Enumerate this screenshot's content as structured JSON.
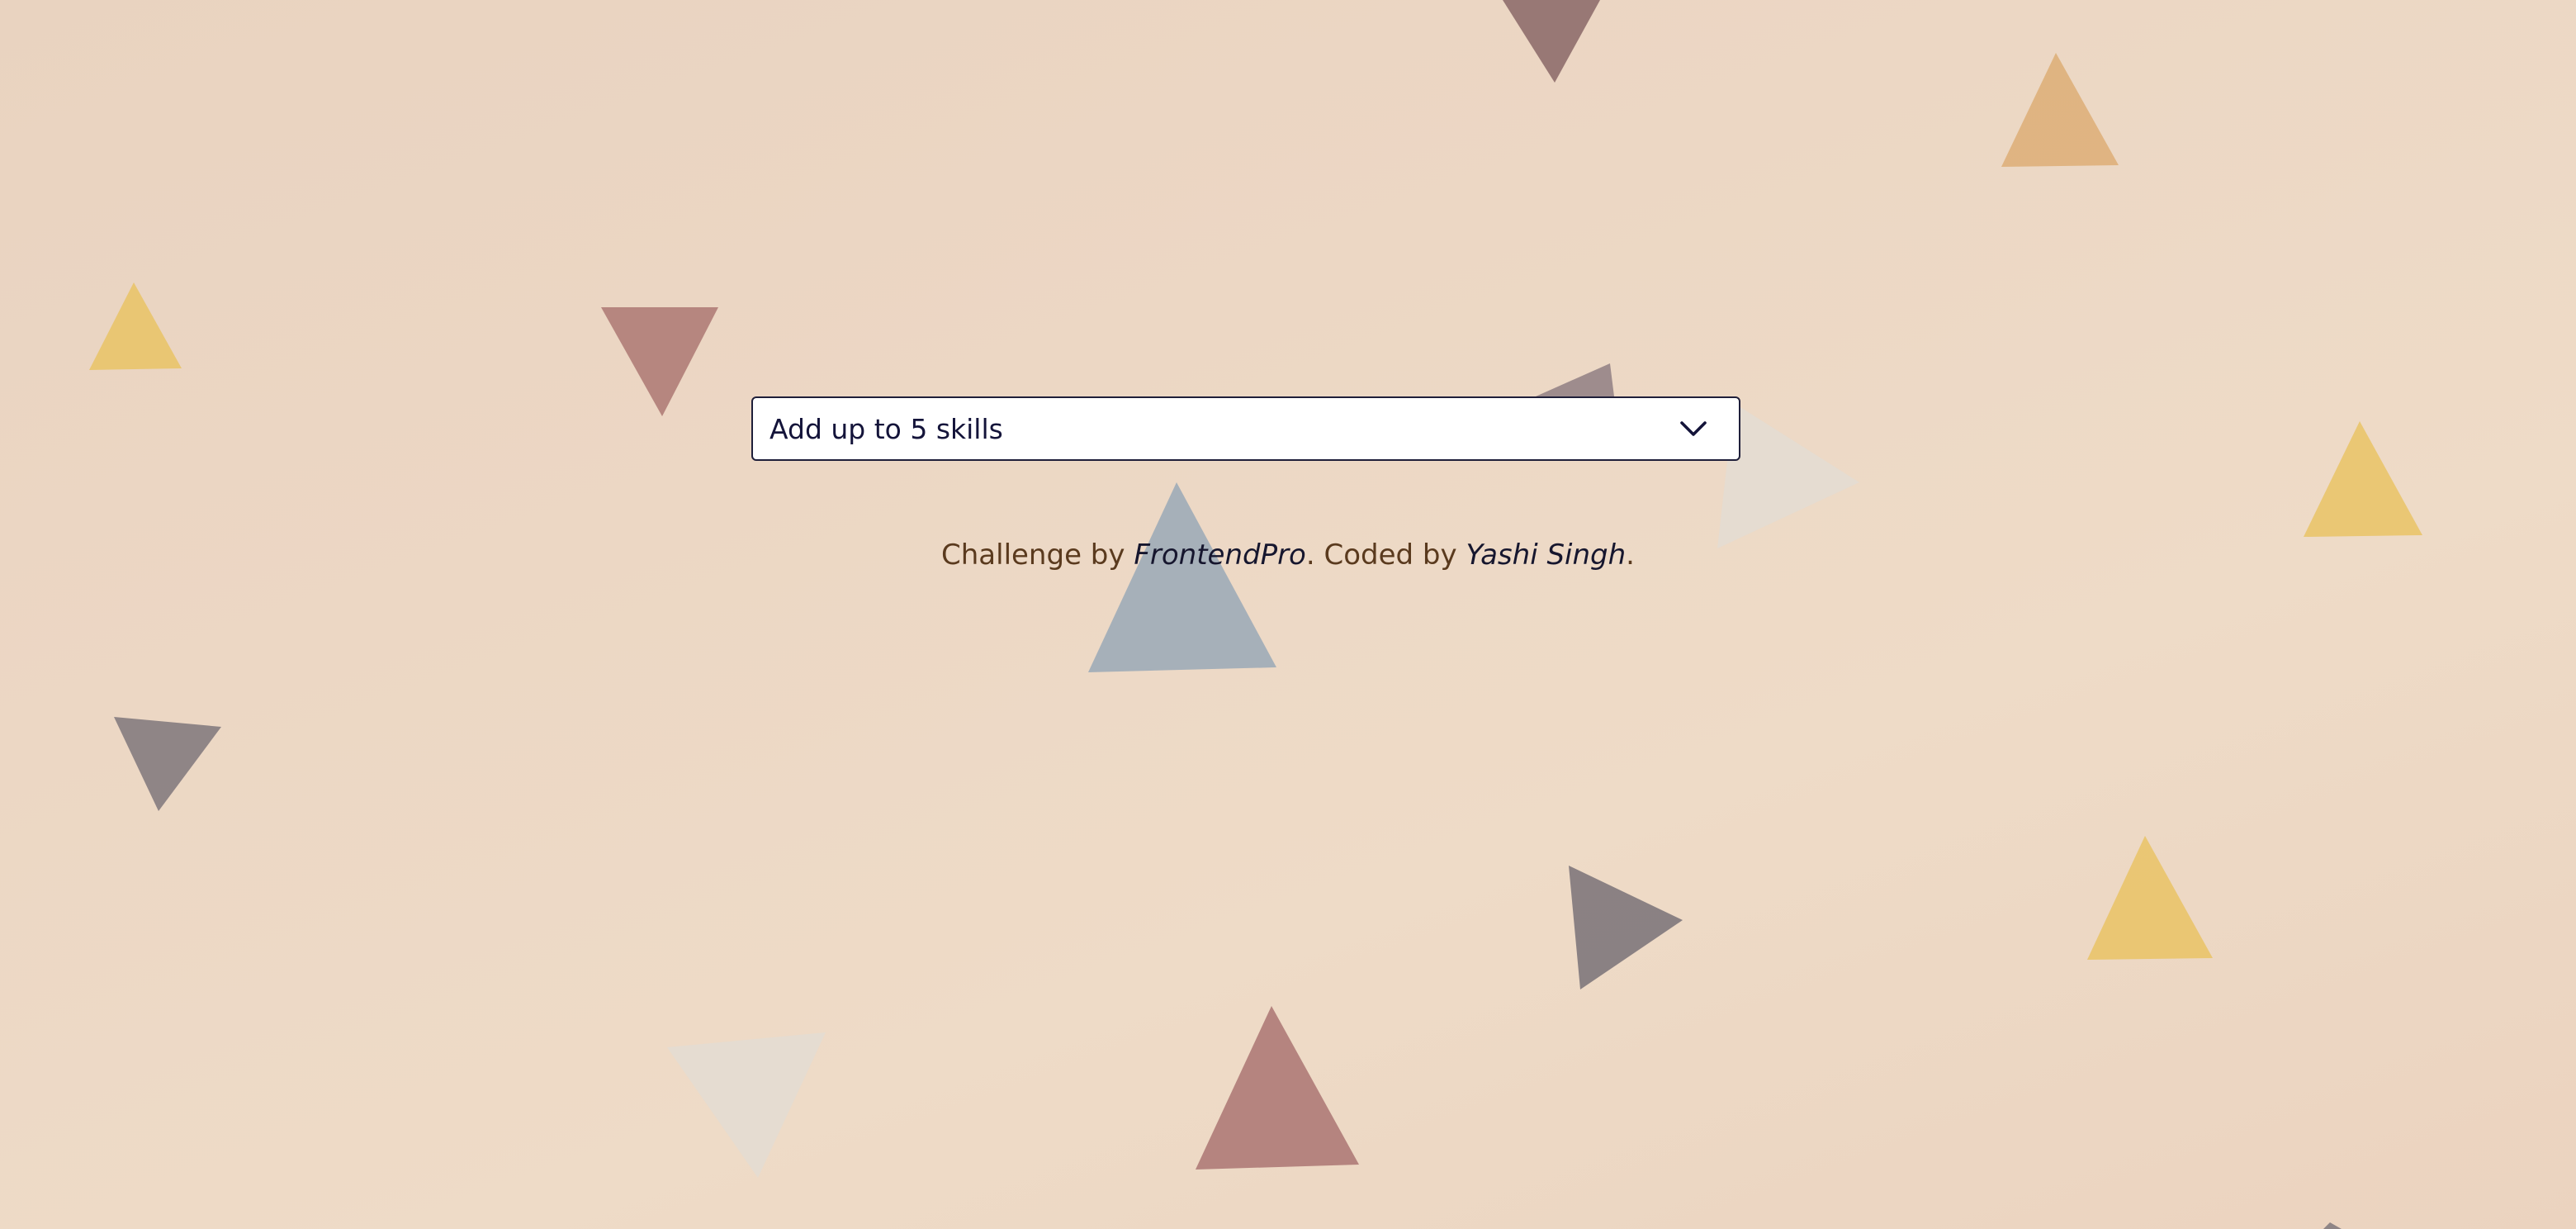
{
  "skills_select": {
    "placeholder": "Add up to 5 skills",
    "icon": "chevron-down-icon"
  },
  "attribution": {
    "prefix": "Challenge by",
    "challenge_link": "FrontendPro",
    "sep1": ".",
    "coded_by": "Coded by",
    "author_link": "Yashi Singh",
    "suffix": "."
  },
  "colors": {
    "background": "#ecd7c4",
    "text_brown": "#5a3a1e",
    "link_dark": "#16162e",
    "select_border": "#1f1f3a",
    "triangle_yellow": "#e9c46a",
    "triangle_rose": "#b07d78",
    "triangle_gray": "#857c80",
    "triangle_blue": "#a2aeb8",
    "triangle_orange": "#deb07a",
    "triangle_pale": "#e3dbd2"
  }
}
